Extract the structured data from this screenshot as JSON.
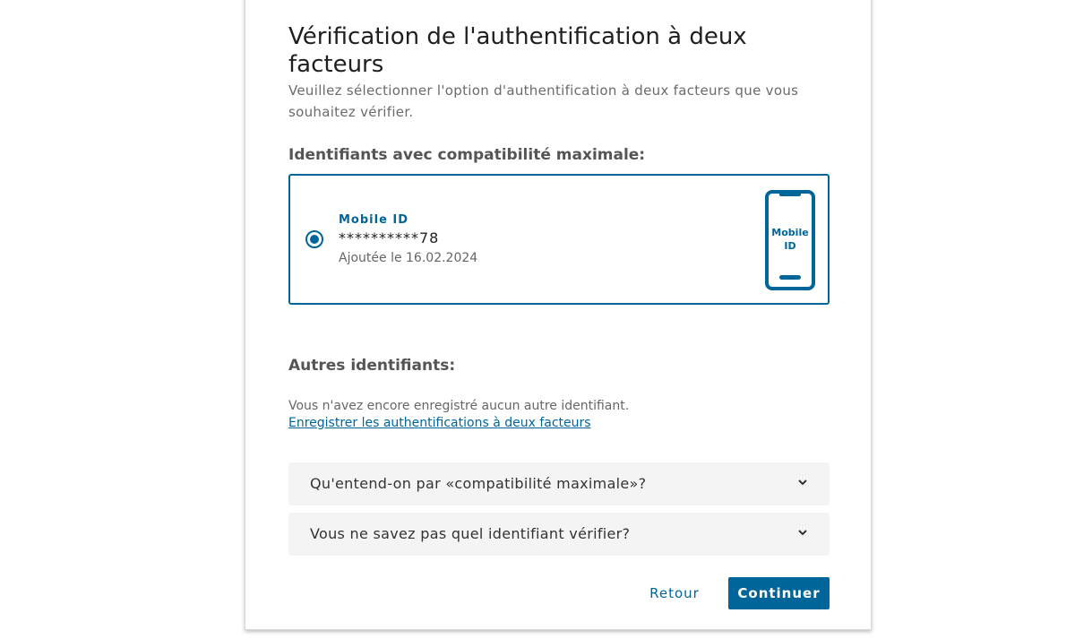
{
  "title": "Vérification de l'authentification à deux facteurs",
  "subtitle": "Veuillez sélectionner l'option d'authentification à deux facteurs que vous souhaitez vérifier.",
  "compat_section": {
    "heading": "Identifiants avec compatibilité maximale:",
    "option": {
      "label": "Mobile ID",
      "number": "**********78",
      "date": "Ajoutée le 16.02.2024",
      "selected": true,
      "icon": "mobile-phone-icon",
      "icon_text_line1": "Mobile",
      "icon_text_line2": "ID"
    }
  },
  "others_section": {
    "heading": "Autres identifiants:",
    "empty_text": "Vous n'avez encore enregistré aucun autre identifiant.",
    "register_link": "Enregistrer les authentifications à deux facteurs"
  },
  "accordions": [
    {
      "title": "Qu'entend-on par «compatibilité maximale»?",
      "icon": "chevron-down-icon"
    },
    {
      "title": "Vous ne savez pas quel identifiant vérifier?",
      "icon": "chevron-down-icon"
    }
  ],
  "buttons": {
    "back": "Retour",
    "continue": "Continuer"
  },
  "colors": {
    "primary": "#006699",
    "accordion_bg": "#f4f4f4",
    "text": "#333333"
  }
}
